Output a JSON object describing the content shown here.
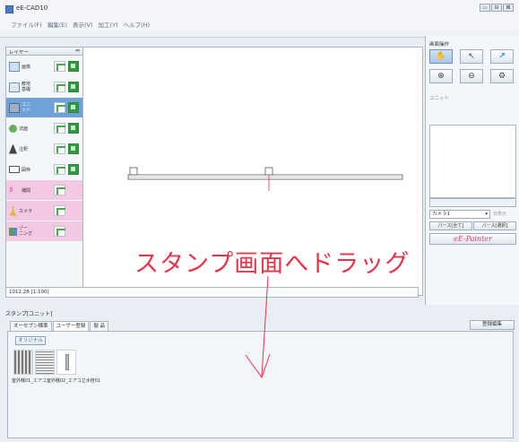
{
  "window": {
    "title": "eE-CAD10",
    "buttons": [
      "▭",
      "⊟",
      "⊠"
    ]
  },
  "menu": [
    "ファイル(F)",
    "編集(E)",
    "表示(V)",
    "加工(Y)",
    "ヘルプ(H)"
  ],
  "layer_panel": {
    "header": "レイヤー",
    "dropdown": "⇔",
    "rows": [
      {
        "label": "画像"
      },
      {
        "label": "敷地\n基礎"
      },
      {
        "label": "ユニ\nット"
      },
      {
        "label": "法面"
      },
      {
        "label": "注釈"
      },
      {
        "label": "図枠"
      },
      {
        "label": "補間"
      },
      {
        "label": "カメラ"
      },
      {
        "label": "ゾー\nニング"
      }
    ]
  },
  "status_bar": {
    "text": "1012.28 [1:100]"
  },
  "right_panel": {
    "view_ops_label": "画面操作",
    "unit_label": "ユニット",
    "camera_select": "カメラ1",
    "hide_label": "非表示",
    "perspective_all": "パース[全て]",
    "perspective_selected": "パース[選択]",
    "painter": "eE-Painter"
  },
  "stamp": {
    "title": "スタンプ[ユニット]",
    "tabs": [
      "オーセブン標準",
      "ユーザー登録",
      "製 品"
    ],
    "register_button": "登録編集",
    "original_button": "オリジナル",
    "thumb_labels": "室外機01_エアコ室外機02_エアコ立水栓01"
  },
  "overlay": {
    "text": "スタンプ画面へドラッグ",
    "color": "#e8344a"
  }
}
